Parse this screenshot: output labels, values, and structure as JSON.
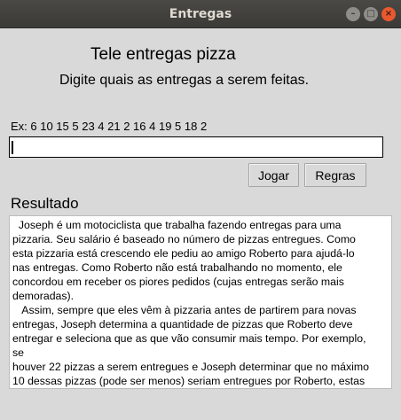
{
  "window": {
    "title": "Entregas",
    "controls": {
      "minimize": "–",
      "maximize": "□",
      "close": "×"
    }
  },
  "main": {
    "heading": "Tele entregas pizza",
    "subheading": "Digite quais as entregas a serem feitas.",
    "example": "Ex: 6 10 15 5 23 4 21 2 16 4 19 5 18 2",
    "entry_value": "",
    "play_label": "Jogar",
    "rules_label": "Regras",
    "result_label": "Resultado",
    "result_lines": [
      "  Joseph é um motociclista que trabalha fazendo entregas para uma",
      "pizzaria. Seu salário é baseado no número de pizzas entregues. Como",
      "esta pizzaria está crescendo ele pediu ao amigo Roberto para ajudá-lo",
      "nas entregas. Como Roberto não está trabalhando no momento, ele",
      "concordou em receber os piores pedidos (cujas entregas serão mais",
      "demoradas).",
      "   Assim, sempre que eles vêm à pizzaria antes de partirem para novas",
      "entregas, Joseph determina a quantidade de pizzas que Roberto deve",
      "entregar e seleciona que as que vão consumir mais tempo. Por exemplo,",
      "se",
      "houver 22 pizzas a serem entregues e Joseph determinar que no máximo",
      "10 dessas pizzas (pode ser menos) seriam entregues por Roberto, estas"
    ]
  }
}
